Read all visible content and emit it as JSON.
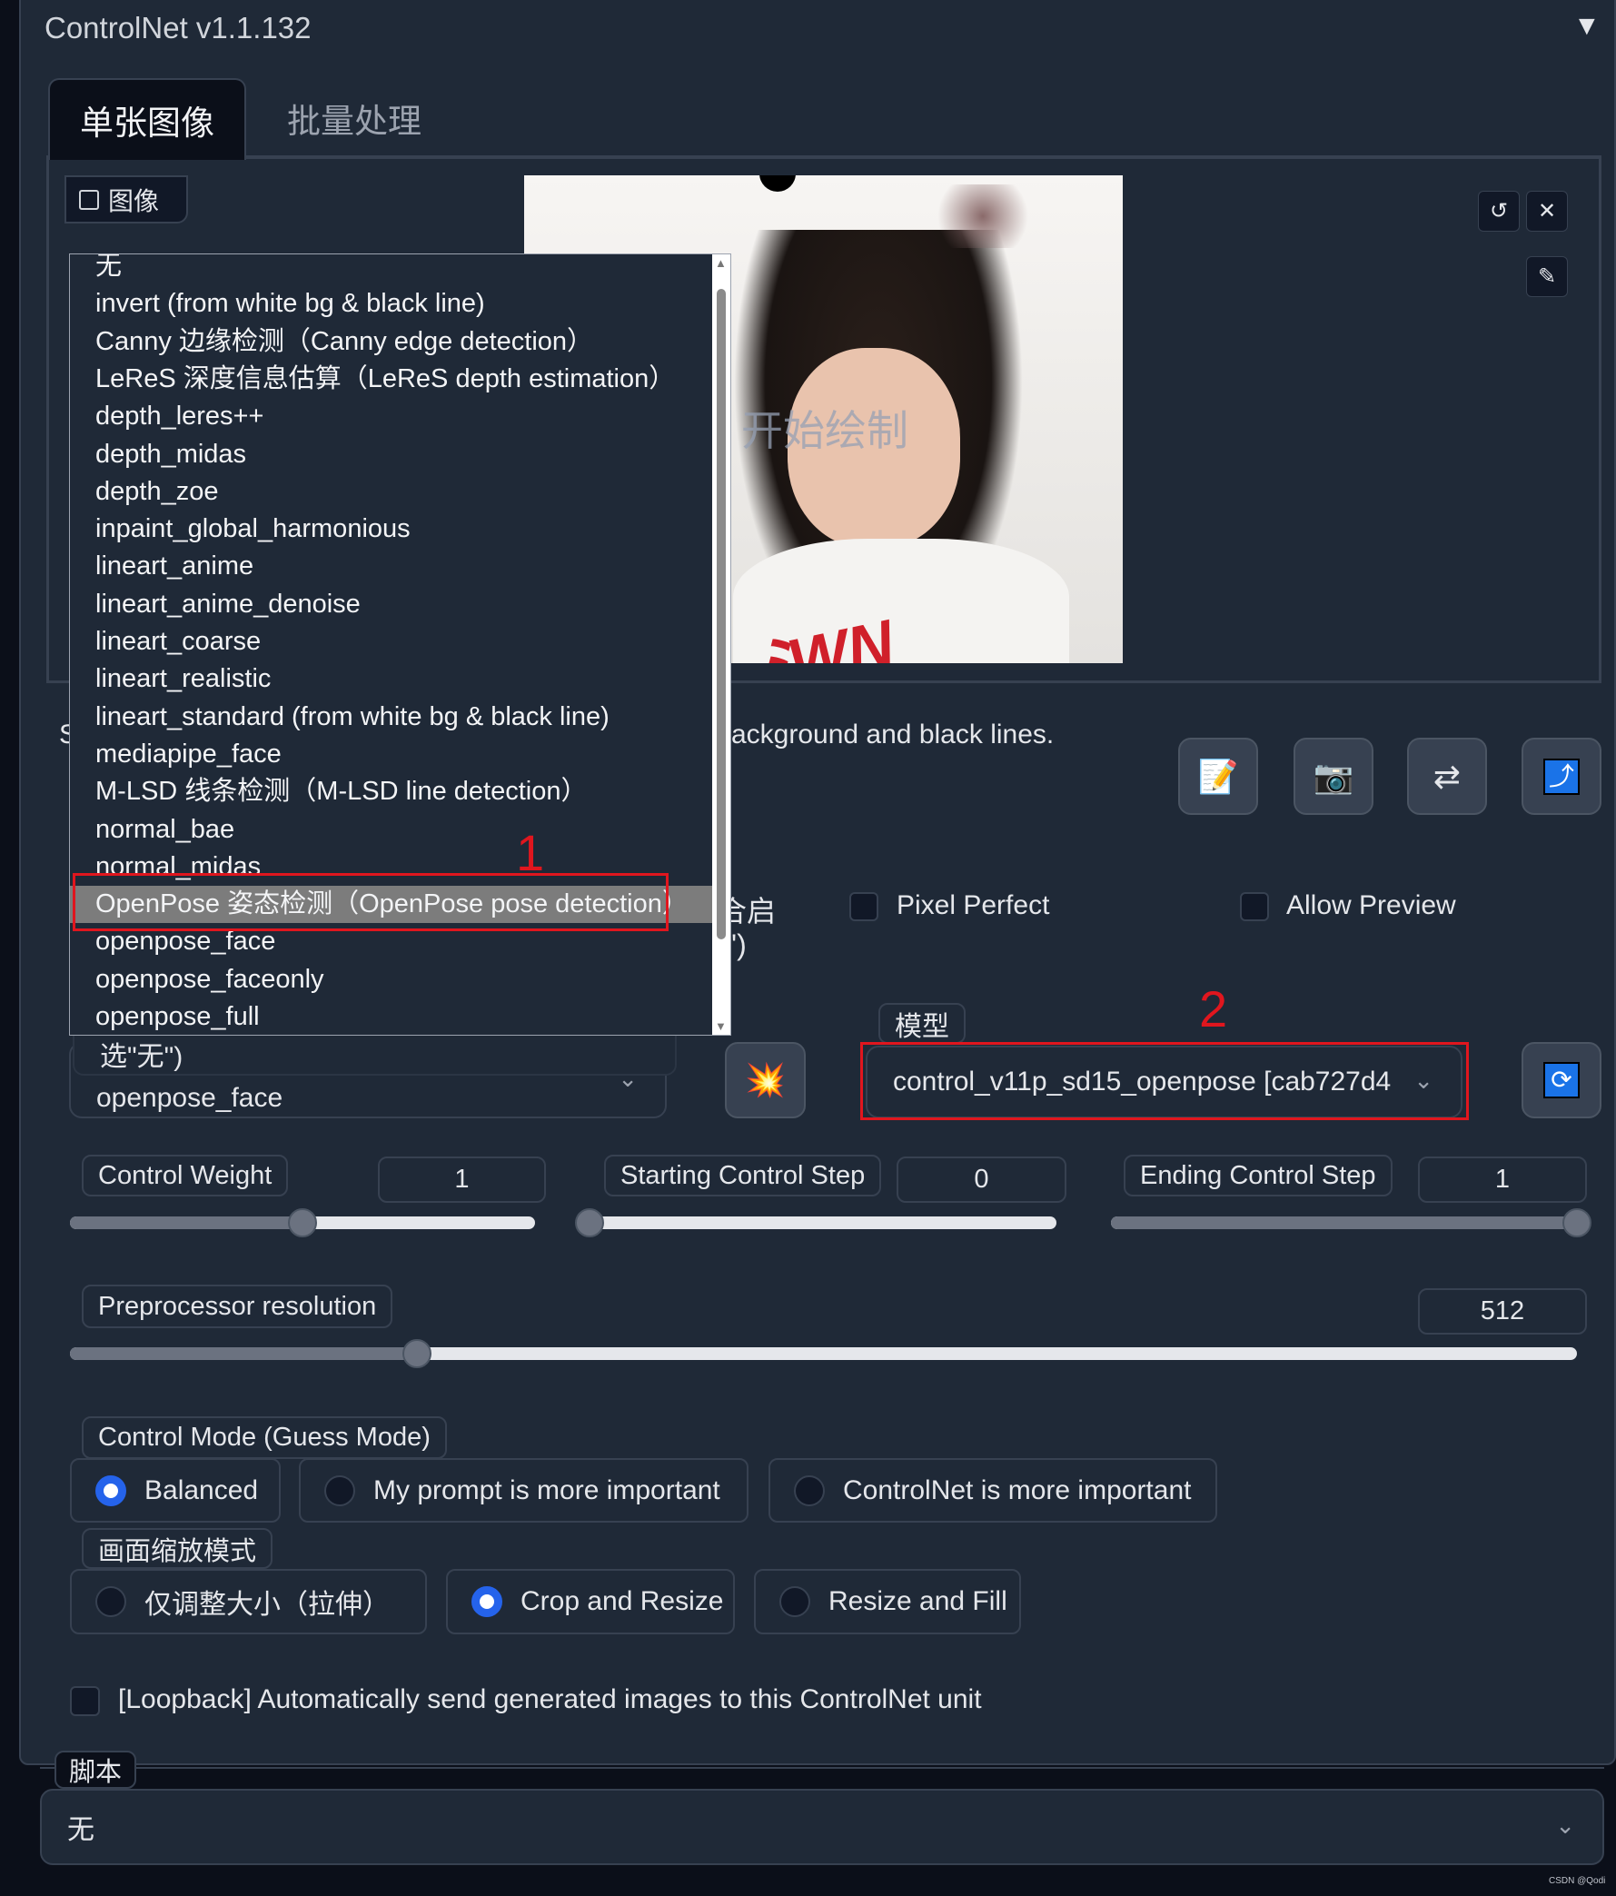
{
  "header": {
    "title": "ControlNet v1.1.132",
    "collapse_icon": "▼"
  },
  "tabs": [
    {
      "label": "单张图像",
      "active": true
    },
    {
      "label": "批量处理",
      "active": false
    }
  ],
  "image_input": {
    "label": "图像",
    "overlay_text": "开始绘制"
  },
  "preprocessor_dropdown": {
    "options": [
      "无",
      "invert (from white bg & black line)",
      "Canny 边缘检测（Canny edge detection）",
      "LeReS 深度信息估算（LeReS depth estimation）",
      "depth_leres++",
      "depth_midas",
      "depth_zoe",
      "inpaint_global_harmonious",
      "lineart_anime",
      "lineart_anime_denoise",
      "lineart_coarse",
      "lineart_realistic",
      "lineart_standard (from white bg & black line)",
      "mediapipe_face",
      "M-LSD 线条检测（M-LSD line detection）",
      "normal_bae",
      "normal_midas",
      "OpenPose 姿态检测（OpenPose pose detection）",
      "openpose_face",
      "openpose_faceonly",
      "openpose_full"
    ],
    "highlighted": "OpenPose 姿态检测（OpenPose pose detection）",
    "selected": "openpose_face",
    "tooltip_fragment": "选\"无\")"
  },
  "description_fragments": {
    "left": "S",
    "right": "ackground and black lines.",
    "enable_fragment": "合启",
    "paren_fragment": "')"
  },
  "checkboxes": {
    "pixel_perfect": {
      "label": "Pixel Perfect",
      "checked": false
    },
    "allow_preview": {
      "label": "Allow Preview",
      "checked": false
    },
    "loopback": {
      "label": "[Loopback] Automatically send generated images to this ControlNet unit",
      "checked": false
    }
  },
  "model": {
    "label": "模型",
    "value": "control_v11p_sd15_openpose [cab727d4"
  },
  "sliders": {
    "control_weight": {
      "label": "Control Weight",
      "value": "1",
      "fraction": 0.5
    },
    "starting_step": {
      "label": "Starting Control Step",
      "value": "0",
      "fraction": 0
    },
    "ending_step": {
      "label": "Ending Control Step",
      "value": "1",
      "fraction": 1
    },
    "preprocessor_resolution": {
      "label": "Preprocessor resolution",
      "value": "512",
      "fraction": 0.23
    }
  },
  "control_mode": {
    "label": "Control Mode (Guess Mode)",
    "options": [
      "Balanced",
      "My prompt is more important",
      "ControlNet is more important"
    ],
    "selected": "Balanced"
  },
  "resize_mode": {
    "label": "画面缩放模式",
    "options": [
      "仅调整大小（拉伸）",
      "Crop and Resize",
      "Resize and Fill"
    ],
    "selected": "Crop and Resize"
  },
  "script": {
    "label": "脚本",
    "value": "无"
  },
  "annotations": {
    "one": "1",
    "two": "2"
  },
  "watermark": "CSDN @Qodi",
  "colors": {
    "panel": "#1f2937",
    "background": "#0b0f19",
    "accent": "#2563eb",
    "annotation": "#e0161e"
  }
}
